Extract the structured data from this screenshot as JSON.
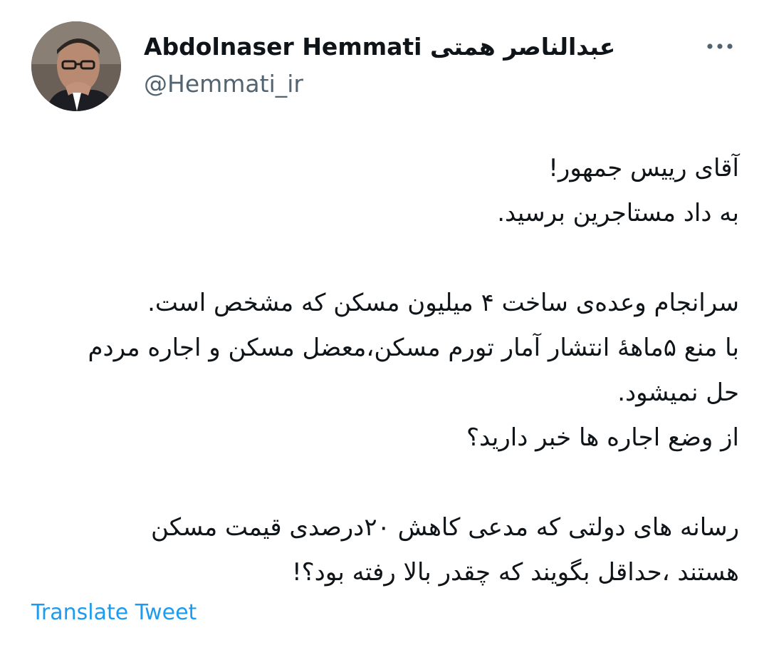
{
  "author": {
    "display_name": "Abdolnaser Hemmati عبدالناصر همتی",
    "handle": "@Hemmati_ir",
    "avatar_icon": "profile-photo"
  },
  "more_icon": "ellipsis-icon",
  "tweet": {
    "lines": [
      "آقای رییس جمهور!",
      "به داد مستاجرین برسید.",
      "",
      "سرانجام وعده‌ی ساخت ۴ میلیون مسکن که مشخص است.",
      "با منع ۵ماههٔ انتشار آمار تورم مسکن،معضل مسکن و اجاره مردم",
      "حل نمیشود.",
      "از وضع اجاره ها خبر دارید؟",
      "",
      "رسانه های دولتی که مدعی  کاهش ۲۰درصدی قیمت مسکن",
      "هستند ،حداقل بگویند که چقدر بالا رفته بود؟!"
    ]
  },
  "translate_label": "Translate Tweet",
  "colors": {
    "text": "#0f1419",
    "secondary": "#536471",
    "link": "#1d9bf0"
  }
}
